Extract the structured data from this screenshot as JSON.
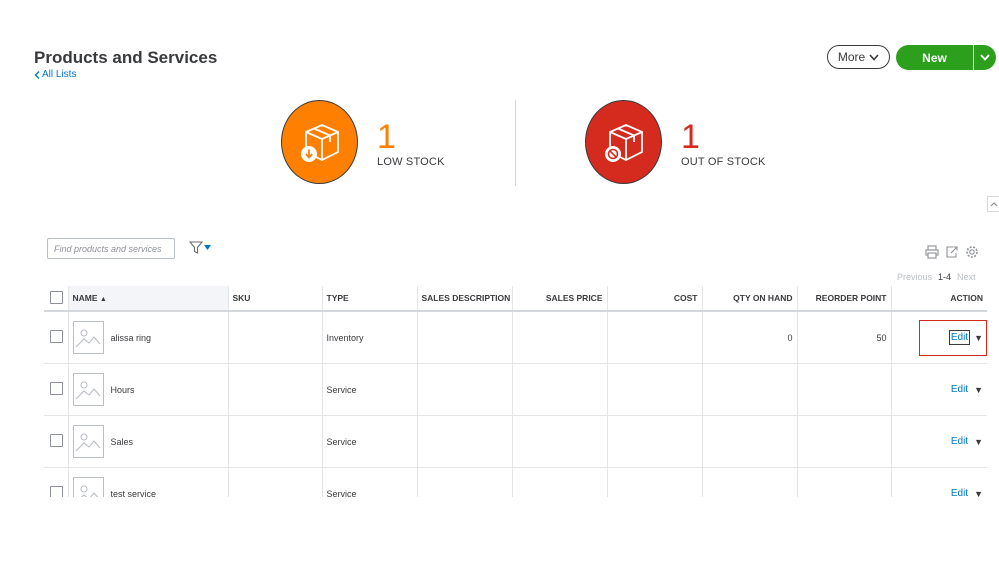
{
  "header": {
    "title": "Products and Services",
    "back_label": "All Lists",
    "more_label": "More",
    "new_label": "New"
  },
  "stock": {
    "low": {
      "count": "1",
      "label": "LOW STOCK",
      "color": "#ff8000"
    },
    "out": {
      "count": "1",
      "label": "OUT OF STOCK",
      "color": "#d52b1e"
    }
  },
  "toolbar": {
    "search_placeholder": "Find products and services",
    "filter_icon": "filter-icon",
    "print_icon": "print-icon",
    "export_icon": "export-icon",
    "settings_icon": "gear-icon"
  },
  "pager": {
    "previous": "Previous",
    "range": "1-4",
    "next": "Next"
  },
  "table": {
    "columns": [
      "NAME",
      "SKU",
      "TYPE",
      "SALES DESCRIPTION",
      "SALES PRICE",
      "COST",
      "QTY ON HAND",
      "REORDER POINT",
      "ACTION"
    ],
    "sort_indicator": "▲",
    "rows": [
      {
        "name": "alissa ring",
        "sku": "",
        "type": "Inventory",
        "sales_description": "",
        "sales_price": "",
        "cost": "",
        "qty_on_hand": "0",
        "reorder_point": "50",
        "action": "Edit"
      },
      {
        "name": "Hours",
        "sku": "",
        "type": "Service",
        "sales_description": "",
        "sales_price": "",
        "cost": "",
        "qty_on_hand": "",
        "reorder_point": "",
        "action": "Edit"
      },
      {
        "name": "Sales",
        "sku": "",
        "type": "Service",
        "sales_description": "",
        "sales_price": "",
        "cost": "",
        "qty_on_hand": "",
        "reorder_point": "",
        "action": "Edit"
      },
      {
        "name": "test service",
        "sku": "",
        "type": "Service",
        "sales_description": "",
        "sales_price": "",
        "cost": "",
        "qty_on_hand": "",
        "reorder_point": "",
        "action": "Edit"
      }
    ]
  },
  "colors": {
    "accent": "#0077c5",
    "primary_button": "#2ca01c",
    "highlight": "#d52b1e"
  }
}
